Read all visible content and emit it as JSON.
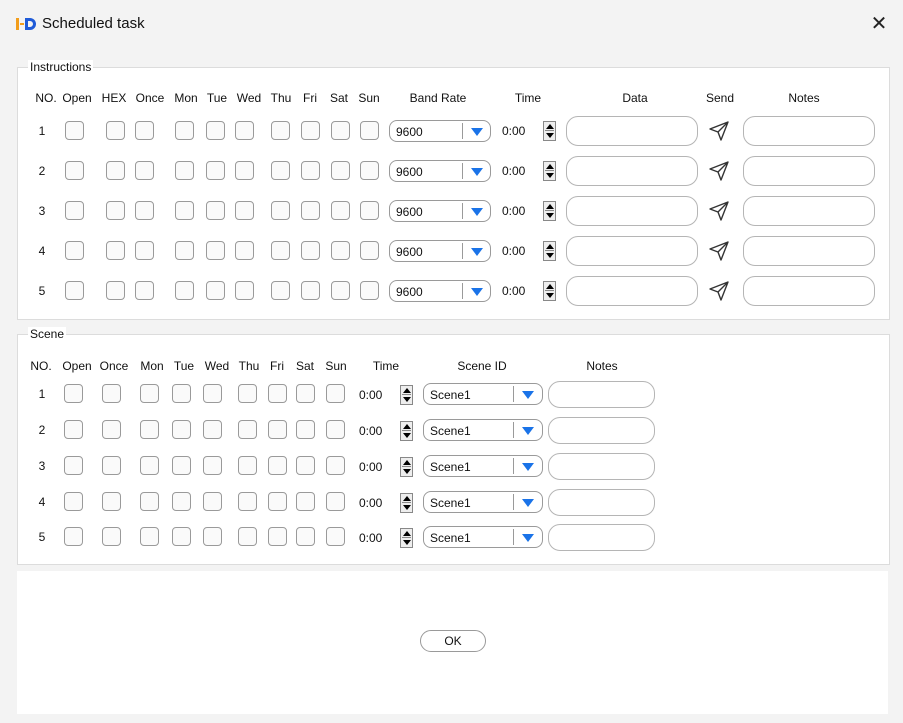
{
  "window": {
    "title": "Scheduled task",
    "close_symbol": "✕"
  },
  "instructions": {
    "label": "Instructions",
    "headers": {
      "no": "NO.",
      "open": "Open",
      "hex": "HEX",
      "once": "Once",
      "mon": "Mon",
      "tue": "Tue",
      "wed": "Wed",
      "thu": "Thu",
      "fri": "Fri",
      "sat": "Sat",
      "sun": "Sun",
      "band_rate": "Band Rate",
      "time": "Time",
      "data": "Data",
      "send": "Send",
      "notes": "Notes"
    },
    "rows": [
      {
        "no": "1",
        "band_rate": "9600",
        "time": "0:00",
        "data": "",
        "notes": ""
      },
      {
        "no": "2",
        "band_rate": "9600",
        "time": "0:00",
        "data": "",
        "notes": ""
      },
      {
        "no": "3",
        "band_rate": "9600",
        "time": "0:00",
        "data": "",
        "notes": ""
      },
      {
        "no": "4",
        "band_rate": "9600",
        "time": "0:00",
        "data": "",
        "notes": ""
      },
      {
        "no": "5",
        "band_rate": "9600",
        "time": "0:00",
        "data": "",
        "notes": ""
      }
    ]
  },
  "scene": {
    "label": "Scene",
    "headers": {
      "no": "NO.",
      "open": "Open",
      "once": "Once",
      "mon": "Mon",
      "tue": "Tue",
      "wed": "Wed",
      "thu": "Thu",
      "fri": "Fri",
      "sat": "Sat",
      "sun": "Sun",
      "time": "Time",
      "scene_id": "Scene ID",
      "notes": "Notes"
    },
    "rows": [
      {
        "no": "1",
        "time": "0:00",
        "scene_id": "Scene1",
        "notes": ""
      },
      {
        "no": "2",
        "time": "0:00",
        "scene_id": "Scene1",
        "notes": ""
      },
      {
        "no": "3",
        "time": "0:00",
        "scene_id": "Scene1",
        "notes": ""
      },
      {
        "no": "4",
        "time": "0:00",
        "scene_id": "Scene1",
        "notes": ""
      },
      {
        "no": "5",
        "time": "0:00",
        "scene_id": "Scene1",
        "notes": ""
      }
    ]
  },
  "footer": {
    "ok_label": "OK"
  },
  "colors": {
    "accent": "#1a73e8",
    "logo_orange": "#f29d1b",
    "logo_blue": "#1f5bd8"
  }
}
